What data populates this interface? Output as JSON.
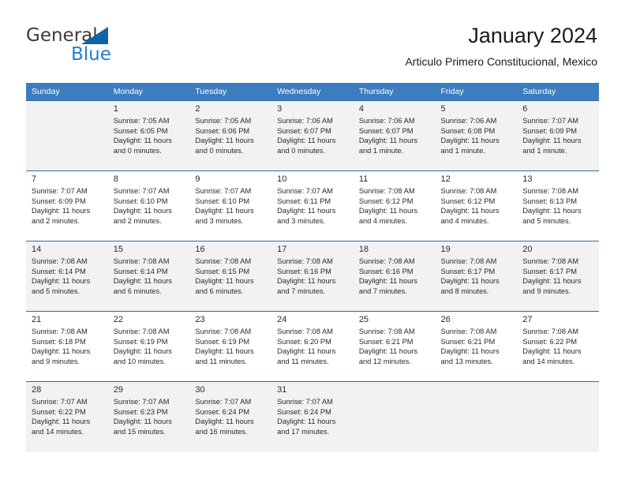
{
  "brand": {
    "name_part1": "General",
    "name_part2": "Blue",
    "accent_color": "#1f7fd0",
    "triangle_color": "#1163a8"
  },
  "header": {
    "title": "January 2024",
    "subtitle": "Articulo Primero Constitucional, Mexico"
  },
  "calendar": {
    "header_bg": "#3c7dc0",
    "weekdays": [
      "Sunday",
      "Monday",
      "Tuesday",
      "Wednesday",
      "Thursday",
      "Friday",
      "Saturday"
    ],
    "weeks": [
      [
        {
          "day": "",
          "sunrise": "",
          "sunset": "",
          "daylight1": "",
          "daylight2": ""
        },
        {
          "day": "1",
          "sunrise": "Sunrise: 7:05 AM",
          "sunset": "Sunset: 6:05 PM",
          "daylight1": "Daylight: 11 hours",
          "daylight2": "and 0 minutes."
        },
        {
          "day": "2",
          "sunrise": "Sunrise: 7:05 AM",
          "sunset": "Sunset: 6:06 PM",
          "daylight1": "Daylight: 11 hours",
          "daylight2": "and 0 minutes."
        },
        {
          "day": "3",
          "sunrise": "Sunrise: 7:06 AM",
          "sunset": "Sunset: 6:07 PM",
          "daylight1": "Daylight: 11 hours",
          "daylight2": "and 0 minutes."
        },
        {
          "day": "4",
          "sunrise": "Sunrise: 7:06 AM",
          "sunset": "Sunset: 6:07 PM",
          "daylight1": "Daylight: 11 hours",
          "daylight2": "and 1 minute."
        },
        {
          "day": "5",
          "sunrise": "Sunrise: 7:06 AM",
          "sunset": "Sunset: 6:08 PM",
          "daylight1": "Daylight: 11 hours",
          "daylight2": "and 1 minute."
        },
        {
          "day": "6",
          "sunrise": "Sunrise: 7:07 AM",
          "sunset": "Sunset: 6:09 PM",
          "daylight1": "Daylight: 11 hours",
          "daylight2": "and 1 minute."
        }
      ],
      [
        {
          "day": "7",
          "sunrise": "Sunrise: 7:07 AM",
          "sunset": "Sunset: 6:09 PM",
          "daylight1": "Daylight: 11 hours",
          "daylight2": "and 2 minutes."
        },
        {
          "day": "8",
          "sunrise": "Sunrise: 7:07 AM",
          "sunset": "Sunset: 6:10 PM",
          "daylight1": "Daylight: 11 hours",
          "daylight2": "and 2 minutes."
        },
        {
          "day": "9",
          "sunrise": "Sunrise: 7:07 AM",
          "sunset": "Sunset: 6:10 PM",
          "daylight1": "Daylight: 11 hours",
          "daylight2": "and 3 minutes."
        },
        {
          "day": "10",
          "sunrise": "Sunrise: 7:07 AM",
          "sunset": "Sunset: 6:11 PM",
          "daylight1": "Daylight: 11 hours",
          "daylight2": "and 3 minutes."
        },
        {
          "day": "11",
          "sunrise": "Sunrise: 7:08 AM",
          "sunset": "Sunset: 6:12 PM",
          "daylight1": "Daylight: 11 hours",
          "daylight2": "and 4 minutes."
        },
        {
          "day": "12",
          "sunrise": "Sunrise: 7:08 AM",
          "sunset": "Sunset: 6:12 PM",
          "daylight1": "Daylight: 11 hours",
          "daylight2": "and 4 minutes."
        },
        {
          "day": "13",
          "sunrise": "Sunrise: 7:08 AM",
          "sunset": "Sunset: 6:13 PM",
          "daylight1": "Daylight: 11 hours",
          "daylight2": "and 5 minutes."
        }
      ],
      [
        {
          "day": "14",
          "sunrise": "Sunrise: 7:08 AM",
          "sunset": "Sunset: 6:14 PM",
          "daylight1": "Daylight: 11 hours",
          "daylight2": "and 5 minutes."
        },
        {
          "day": "15",
          "sunrise": "Sunrise: 7:08 AM",
          "sunset": "Sunset: 6:14 PM",
          "daylight1": "Daylight: 11 hours",
          "daylight2": "and 6 minutes."
        },
        {
          "day": "16",
          "sunrise": "Sunrise: 7:08 AM",
          "sunset": "Sunset: 6:15 PM",
          "daylight1": "Daylight: 11 hours",
          "daylight2": "and 6 minutes."
        },
        {
          "day": "17",
          "sunrise": "Sunrise: 7:08 AM",
          "sunset": "Sunset: 6:16 PM",
          "daylight1": "Daylight: 11 hours",
          "daylight2": "and 7 minutes."
        },
        {
          "day": "18",
          "sunrise": "Sunrise: 7:08 AM",
          "sunset": "Sunset: 6:16 PM",
          "daylight1": "Daylight: 11 hours",
          "daylight2": "and 7 minutes."
        },
        {
          "day": "19",
          "sunrise": "Sunrise: 7:08 AM",
          "sunset": "Sunset: 6:17 PM",
          "daylight1": "Daylight: 11 hours",
          "daylight2": "and 8 minutes."
        },
        {
          "day": "20",
          "sunrise": "Sunrise: 7:08 AM",
          "sunset": "Sunset: 6:17 PM",
          "daylight1": "Daylight: 11 hours",
          "daylight2": "and 9 minutes."
        }
      ],
      [
        {
          "day": "21",
          "sunrise": "Sunrise: 7:08 AM",
          "sunset": "Sunset: 6:18 PM",
          "daylight1": "Daylight: 11 hours",
          "daylight2": "and 9 minutes."
        },
        {
          "day": "22",
          "sunrise": "Sunrise: 7:08 AM",
          "sunset": "Sunset: 6:19 PM",
          "daylight1": "Daylight: 11 hours",
          "daylight2": "and 10 minutes."
        },
        {
          "day": "23",
          "sunrise": "Sunrise: 7:08 AM",
          "sunset": "Sunset: 6:19 PM",
          "daylight1": "Daylight: 11 hours",
          "daylight2": "and 11 minutes."
        },
        {
          "day": "24",
          "sunrise": "Sunrise: 7:08 AM",
          "sunset": "Sunset: 6:20 PM",
          "daylight1": "Daylight: 11 hours",
          "daylight2": "and 11 minutes."
        },
        {
          "day": "25",
          "sunrise": "Sunrise: 7:08 AM",
          "sunset": "Sunset: 6:21 PM",
          "daylight1": "Daylight: 11 hours",
          "daylight2": "and 12 minutes."
        },
        {
          "day": "26",
          "sunrise": "Sunrise: 7:08 AM",
          "sunset": "Sunset: 6:21 PM",
          "daylight1": "Daylight: 11 hours",
          "daylight2": "and 13 minutes."
        },
        {
          "day": "27",
          "sunrise": "Sunrise: 7:08 AM",
          "sunset": "Sunset: 6:22 PM",
          "daylight1": "Daylight: 11 hours",
          "daylight2": "and 14 minutes."
        }
      ],
      [
        {
          "day": "28",
          "sunrise": "Sunrise: 7:07 AM",
          "sunset": "Sunset: 6:22 PM",
          "daylight1": "Daylight: 11 hours",
          "daylight2": "and 14 minutes."
        },
        {
          "day": "29",
          "sunrise": "Sunrise: 7:07 AM",
          "sunset": "Sunset: 6:23 PM",
          "daylight1": "Daylight: 11 hours",
          "daylight2": "and 15 minutes."
        },
        {
          "day": "30",
          "sunrise": "Sunrise: 7:07 AM",
          "sunset": "Sunset: 6:24 PM",
          "daylight1": "Daylight: 11 hours",
          "daylight2": "and 16 minutes."
        },
        {
          "day": "31",
          "sunrise": "Sunrise: 7:07 AM",
          "sunset": "Sunset: 6:24 PM",
          "daylight1": "Daylight: 11 hours",
          "daylight2": "and 17 minutes."
        },
        {
          "day": "",
          "sunrise": "",
          "sunset": "",
          "daylight1": "",
          "daylight2": ""
        },
        {
          "day": "",
          "sunrise": "",
          "sunset": "",
          "daylight1": "",
          "daylight2": ""
        },
        {
          "day": "",
          "sunrise": "",
          "sunset": "",
          "daylight1": "",
          "daylight2": ""
        }
      ]
    ]
  }
}
